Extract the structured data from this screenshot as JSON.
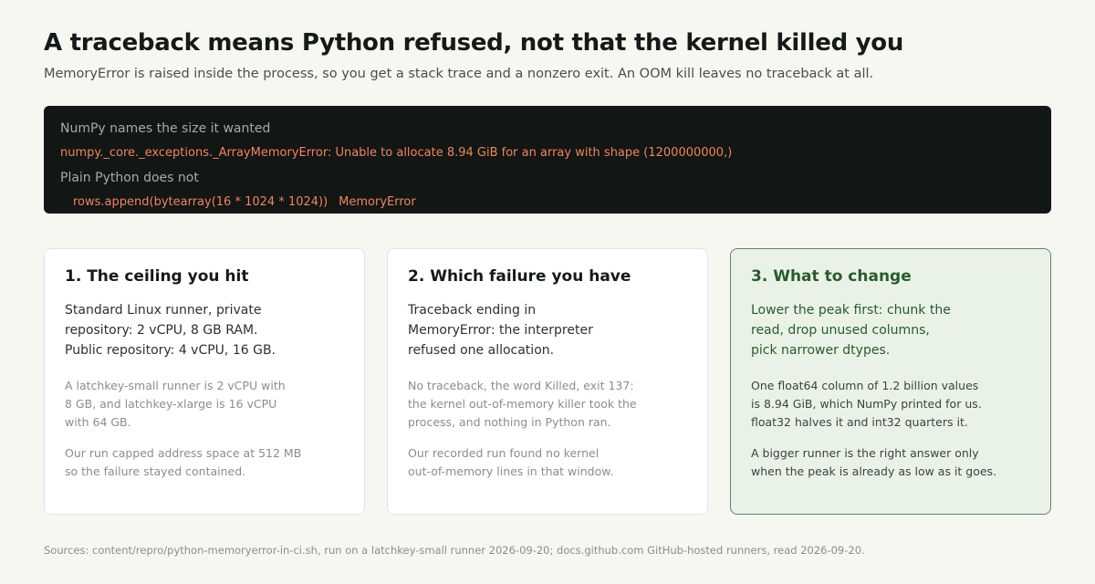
{
  "header": {
    "title": "A traceback means Python refused, not that the kernel killed you",
    "subtitle": "MemoryError is raised inside the process, so you get a stack trace and a nonzero exit. An OOM kill leaves no traceback at all."
  },
  "terminal": {
    "comment_1": "NumPy names the size it wanted",
    "error_line": "numpy._core._exceptions._ArrayMemoryError: Unable to allocate 8.94 GiB for an array with shape (1200000000,)",
    "comment_2": "Plain Python does not",
    "code_line": "rows.append(bytearray(16 * 1024 * 1024))",
    "code_error": "MemoryError"
  },
  "cards": [
    {
      "title": "1. The ceiling you hit",
      "lead": [
        "Standard Linux runner, private",
        "repository: 2 vCPU, 8 GB RAM.",
        "Public repository: 4 vCPU, 16 GB."
      ],
      "detail": [
        "A latchkey-small runner is 2 vCPU with",
        "8 GB, and latchkey-xlarge is 16 vCPU",
        "with 64 GB."
      ],
      "note": [
        "Our run capped address space at 512 MB",
        "so the failure stayed contained."
      ]
    },
    {
      "title": "2. Which failure you have",
      "lead": [
        "Traceback ending in",
        "MemoryError: the interpreter",
        "refused one allocation."
      ],
      "detail": [
        "No traceback, the word Killed, exit 137:",
        "the kernel out-of-memory killer took the",
        "process, and nothing in Python ran."
      ],
      "note": [
        "Our recorded run found no kernel",
        "out-of-memory lines in that window."
      ]
    },
    {
      "title": "3. What to change",
      "lead": [
        "Lower the peak first: chunk the",
        "read, drop unused columns,",
        "pick narrower dtypes."
      ],
      "detail": [
        "One float64 column of 1.2 billion values",
        "is 8.94 GiB, which NumPy printed for us.",
        "float32 halves it and int32 quarters it."
      ],
      "note": [
        "A bigger runner is the right answer only",
        "when the peak is already as low as it goes."
      ]
    }
  ],
  "footer": {
    "sources": "Sources: content/repro/python-memoryerror-in-ci.sh, run on a latchkey-small runner 2026-09-20; docs.github.com GitHub-hosted runners, read 2026-09-20."
  },
  "colors": {
    "background": "#f6f6f2",
    "terminal_bg": "#121614",
    "error_orange": "#f0845a",
    "accent_green": "#265c2c",
    "accent_card_bg": "#eaf2e8"
  }
}
